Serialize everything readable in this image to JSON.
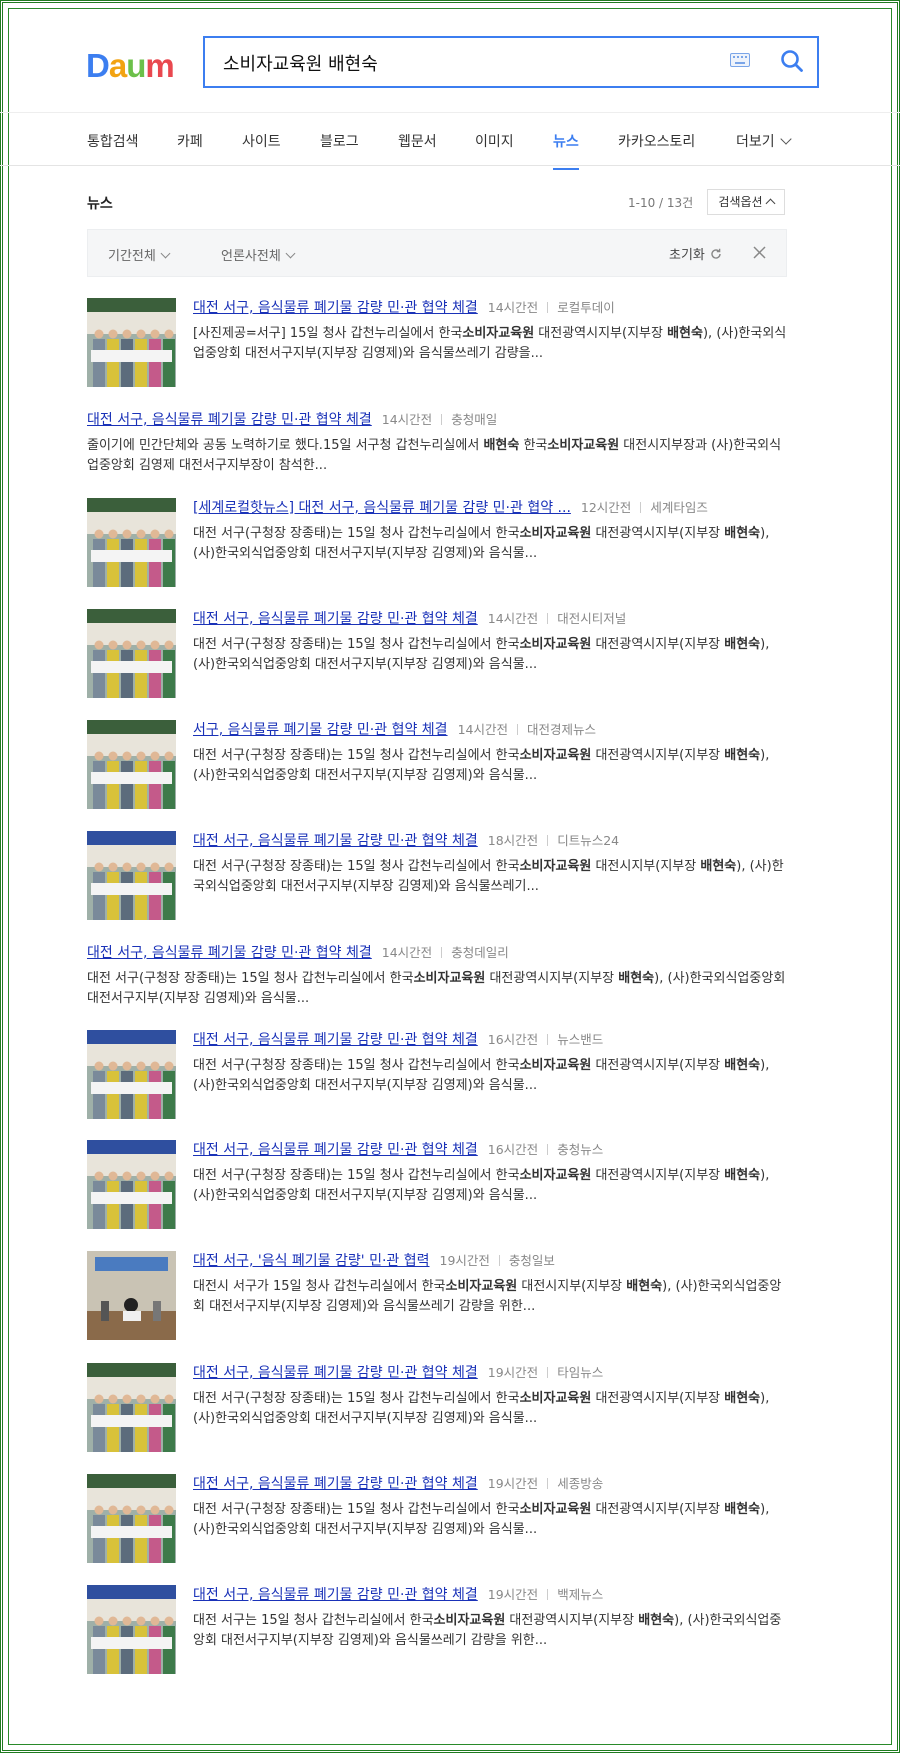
{
  "logo": {
    "d": "D",
    "a": "a",
    "u": "u",
    "m": "m"
  },
  "search": {
    "query": "소비자교육원 배현숙"
  },
  "tabs": [
    "통합검색",
    "카페",
    "사이트",
    "블로그",
    "웹문서",
    "이미지",
    "뉴스",
    "카카오스토리",
    "더보기"
  ],
  "active_tab": "뉴스",
  "section": {
    "title": "뉴스",
    "count": "1-10 / 13건",
    "options_label": "검색옵션",
    "filter_period": "기간전체",
    "filter_press": "언론사전체",
    "reset_label": "초기화"
  },
  "results": [
    {
      "title": "대전 서구, 음식물류 폐기물 감량 민·관 협약 체결",
      "time": "14시간전",
      "source": "로컬투데이",
      "desc1": "[사진제공=서구] 15일 청사 갑천누리실에서 한국",
      "b1": "소비자교육원",
      "desc2": " 대전광역시지부(지부장 ",
      "b2": "배현숙",
      "desc3": "), (사)한국외식업중앙회 대전서구지부(지부장 김영제)와 음식물쓰레기 감량을..."
    },
    {
      "title": "대전 서구, 음식물류 폐기물 감량 민·관 협약 체결",
      "time": "14시간전",
      "source": "충청매일",
      "desc1": "줄이기에 민간단체와 공동 노력하기로 했다.15일 서구청 갑천누리실에서 ",
      "b1": "배현숙",
      "desc2": " 한국",
      "b2": "소비자교육원",
      "desc3": " 대전시지부장과 (사)한국외식업중앙회 김영제 대전서구지부장이 참석한..."
    },
    {
      "title": "[세계로컬핫뉴스] 대전 서구, 음식물류 폐기물 감량 민·관 협약 ...",
      "time": "12시간전",
      "source": "세계타임즈",
      "desc1": "대전 서구(구청장 장종태)는 15일 청사 갑천누리실에서 한국",
      "b1": "소비자교육원",
      "desc2": " 대전광역시지부(지부장 ",
      "b2": "배현숙",
      "desc3": "), (사)한국외식업중앙회 대전서구지부(지부장 김영제)와 음식물..."
    },
    {
      "title": "대전 서구, 음식물류 폐기물 감량 민·관 협약 체결",
      "time": "14시간전",
      "source": "대전시티저널",
      "desc1": "대전 서구(구청장 장종태)는 15일 청사 갑천누리실에서 한국",
      "b1": "소비자교육원",
      "desc2": " 대전광역시지부(지부장 ",
      "b2": "배현숙",
      "desc3": "), (사)한국외식업중앙회 대전서구지부(지부장 김영제)와 음식물..."
    },
    {
      "title": "서구, 음식물류 폐기물 감량 민·관 협약 체결",
      "time": "14시간전",
      "source": "대전경제뉴스",
      "desc1": "대전 서구(구청장 장종태)는 15일 청사 갑천누리실에서 한국",
      "b1": "소비자교육원",
      "desc2": " 대전광역시지부(지부장 ",
      "b2": "배현숙",
      "desc3": "), (사)한국외식업중앙회 대전서구지부(지부장 김영제)와 음식물..."
    },
    {
      "title": "대전 서구, 음식물류 폐기물 감량 민·관 협약 체결",
      "time": "18시간전",
      "source": "디트뉴스24",
      "desc1": "대전 서구(구청장 장종태)는 15일 청사 갑천누리실에서 한국",
      "b1": "소비자교육원",
      "desc2": " 대전시지부(지부장 ",
      "b2": "배현숙",
      "desc3": "), (사)한국외식업중앙회 대전서구지부(지부장 김영제)와 음식물쓰레기..."
    },
    {
      "title": "대전 서구, 음식물류 폐기물 감량 민·관 협약 체결",
      "time": "14시간전",
      "source": "충청데일리",
      "desc1": "대전 서구(구청장 장종태)는 15일 청사 갑천누리실에서 한국",
      "b1": "소비자교육원",
      "desc2": " 대전광역시지부(지부장 ",
      "b2": "배현숙",
      "desc3": "), (사)한국외식업중앙회 대전서구지부(지부장 김영제)와 음식물..."
    },
    {
      "title": "대전 서구, 음식물류 폐기물 감량 민·관 협약 체결",
      "time": "16시간전",
      "source": "뉴스밴드",
      "desc1": "대전 서구(구청장 장종태)는 15일 청사 갑천누리실에서 한국",
      "b1": "소비자교육원",
      "desc2": " 대전광역시지부(지부장 ",
      "b2": "배현숙",
      "desc3": "), (사)한국외식업중앙회 대전서구지부(지부장 김영제)와 음식물..."
    },
    {
      "title": "대전 서구, 음식물류 폐기물 감량 민·관 협약 체결",
      "time": "16시간전",
      "source": "충청뉴스",
      "desc1": "대전 서구(구청장 장종태)는 15일 청사 갑천누리실에서 한국",
      "b1": "소비자교육원",
      "desc2": " 대전광역시지부(지부장 ",
      "b2": "배현숙",
      "desc3": "), (사)한국외식업중앙회 대전서구지부(지부장 김영제)와 음식물..."
    },
    {
      "title": "대전 서구, '음식 폐기물 감량' 민·관 협력",
      "time": "19시간전",
      "source": "충청일보",
      "desc1": "대전시 서구가 15일 청사 갑천누리실에서 한국",
      "b1": "소비자교육원",
      "desc2": " 대전시지부(지부장 ",
      "b2": "배현숙",
      "desc3": "), (사)한국외식업중앙회 대전서구지부(지부장 김영제)와 음식물쓰레기 감량을 위한..."
    },
    {
      "title": "대전 서구, 음식물류 폐기물 감량 민·관 협약 체결",
      "time": "19시간전",
      "source": "타임뉴스",
      "desc1": "대전 서구(구청장 장종태)는 15일 청사 갑천누리실에서 한국",
      "b1": "소비자교육원",
      "desc2": " 대전광역시지부(지부장 ",
      "b2": "배현숙",
      "desc3": "), (사)한국외식업중앙회 대전서구지부(지부장 김영제)와 음식물..."
    },
    {
      "title": "대전 서구, 음식물류 폐기물 감량 민·관 협약 체결",
      "time": "19시간전",
      "source": "세종방송",
      "desc1": "대전 서구(구청장 장종태)는 15일 청사 갑천누리실에서 한국",
      "b1": "소비자교육원",
      "desc2": " 대전광역시지부(지부장 ",
      "b2": "배현숙",
      "desc3": "), (사)한국외식업중앙회 대전서구지부(지부장 김영제)와 음식물..."
    },
    {
      "title": "대전 서구, 음식물류 폐기물 감량 민·관 협약 체결",
      "time": "19시간전",
      "source": "백제뉴스",
      "desc1": "대전 서구는 15일 청사 갑천누리실에서 한국",
      "b1": "소비자교육원",
      "desc2": " 대전광역시지부(지부장 ",
      "b2": "배현숙",
      "desc3": "), (사)한국외식업중앙회 대전서구지부(지부장 김영제)와 음식물쓰레기 감량을 위한..."
    }
  ],
  "colors": {
    "accent": "#3c7ef0",
    "link": "#1a32b8",
    "frame": "#1f7a1f"
  }
}
